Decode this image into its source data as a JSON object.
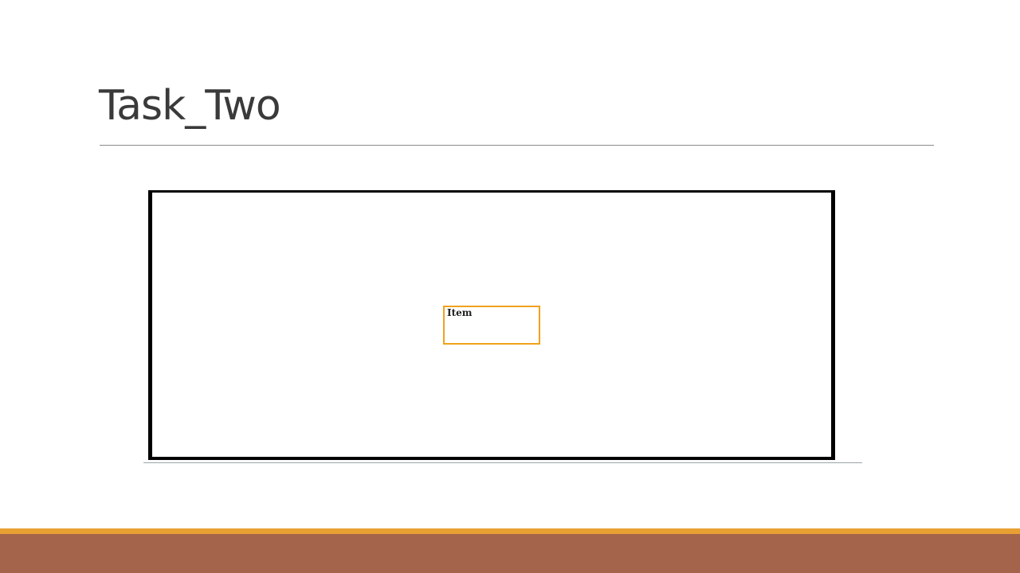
{
  "slide": {
    "title": "Task_Two"
  },
  "diagram": {
    "item_label": "Item"
  },
  "colors": {
    "title_text": "#3a3a3a",
    "frame_border": "#000000",
    "item_border": "#f0a21d",
    "footer_accent": "#e8a033",
    "footer_band": "#a3644b"
  }
}
